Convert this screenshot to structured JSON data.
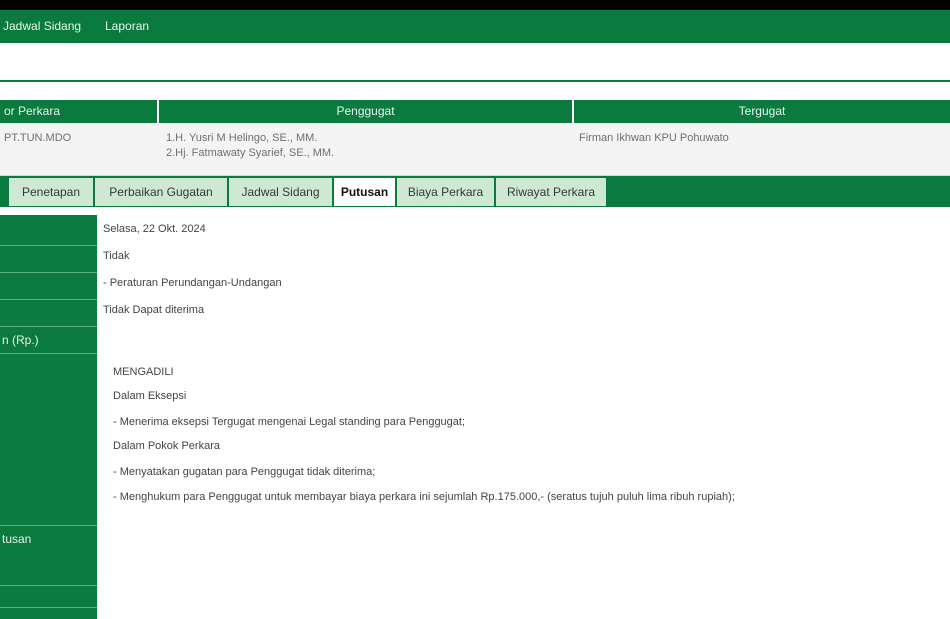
{
  "nav": {
    "items": [
      "Jadwal Sidang",
      "Laporan"
    ]
  },
  "case_table": {
    "headers": [
      "or Perkara",
      "Penggugat",
      "Tergugat"
    ],
    "nomor": "PT.TUN.MDO",
    "penggugat": [
      "1.H. Yusri M Helingo, SE., MM.",
      "2.Hj. Fatmawaty Syarief, SE., MM."
    ],
    "tergugat": "Firman Ikhwan KPU Pohuwato"
  },
  "tabs": [
    "Penetapan",
    "Perbaikan Gugatan",
    "Jadwal Sidang",
    "Putusan",
    "Biaya Perkara",
    "Riwayat Perkara"
  ],
  "active_tab": "Putusan",
  "detail": {
    "labels": [
      "",
      "",
      "",
      "",
      "n (Rp.)",
      "",
      "tusan"
    ],
    "values": [
      "Selasa, 22 Okt. 2024",
      "Tidak",
      "- Peraturan Perundangan-Undangan",
      "Tidak Dapat diterima"
    ],
    "ruling": [
      "MENGADILI",
      "Dalam Eksepsi",
      "-  Menerima eksepsi Tergugat mengenai Legal standing para Penggugat;",
      "Dalam Pokok Perkara",
      "-  Menyatakan gugatan para Penggugat tidak diterima;",
      "-  Menghukum para Penggugat untuk membayar biaya perkara ini sejumlah Rp.175.000,- (seratus tujuh puluh lima ribuh rupiah);"
    ]
  },
  "colors": {
    "primary_green": "#0b7a3e",
    "tab_inactive": "#cfe8d4",
    "background": "#ffffff"
  }
}
